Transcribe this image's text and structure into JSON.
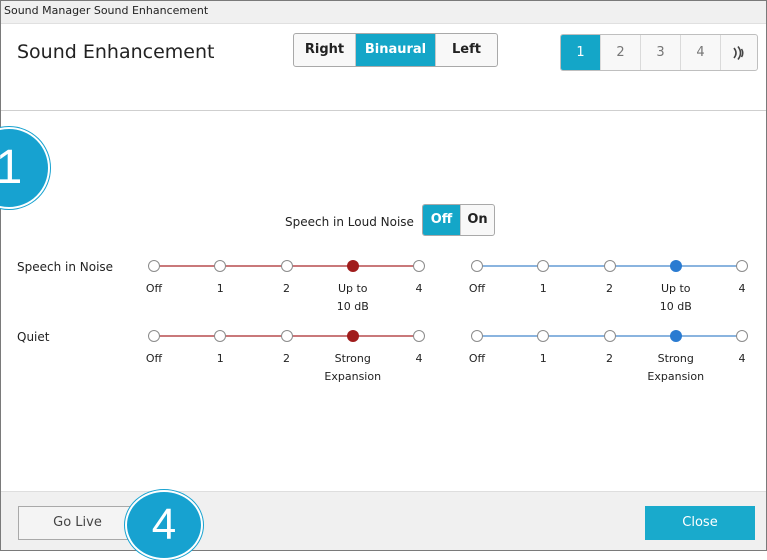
{
  "window": {
    "title": "Sound Manager Sound Enhancement"
  },
  "header": {
    "title": "Sound Enhancement",
    "sides": [
      {
        "label": "Right",
        "active": false
      },
      {
        "label": "Binaural",
        "active": true
      },
      {
        "label": "Left",
        "active": false
      }
    ],
    "programs": [
      {
        "label": "1",
        "active": true
      },
      {
        "label": "2",
        "active": false
      },
      {
        "label": "3",
        "active": false
      },
      {
        "label": "4",
        "active": false
      }
    ],
    "stream_icon": "stream-icon"
  },
  "speech_in_loud_noise": {
    "label": "Speech in Loud Noise",
    "options": [
      "Off",
      "On"
    ],
    "selected": "Off"
  },
  "rows": [
    {
      "label": "Speech in Noise",
      "ticks": [
        "Off",
        "1",
        "2",
        "Up to\n10 dB",
        "4"
      ],
      "right_selected_index": 3,
      "left_selected_index": 3
    },
    {
      "label": "Quiet",
      "ticks": [
        "Off",
        "1",
        "2",
        "Strong\nExpansion",
        "4"
      ],
      "right_selected_index": 3,
      "left_selected_index": 3
    }
  ],
  "colors": {
    "accent": "#14a6c8",
    "right_ear": "#a01c1c",
    "right_track": "#c9787a",
    "left_ear": "#2a7bd1",
    "left_track": "#8ab4df"
  },
  "footer": {
    "go_live": "Go Live",
    "close": "Close"
  },
  "callouts": [
    "1",
    "4"
  ]
}
